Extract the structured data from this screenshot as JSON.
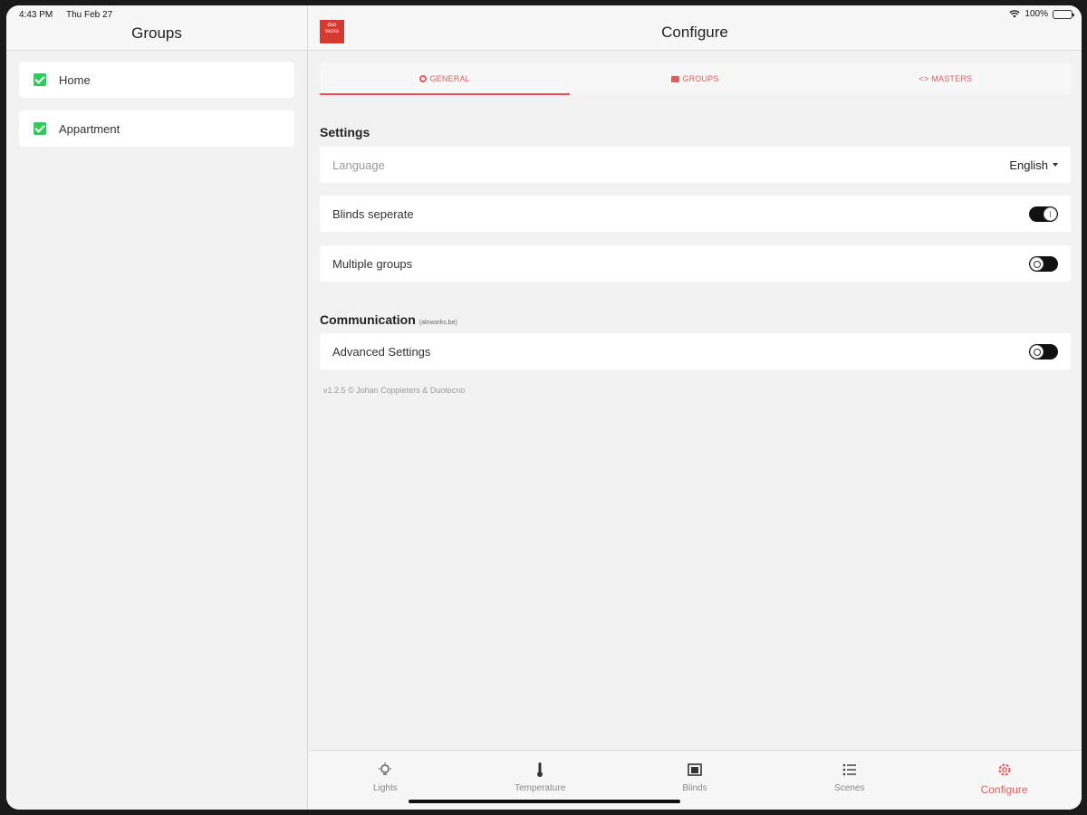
{
  "status": {
    "time": "4:43 PM",
    "date": "Thu Feb 27",
    "battery": "100%"
  },
  "left": {
    "title": "Groups",
    "groups": [
      {
        "label": "Home",
        "checked": true
      },
      {
        "label": "Appartment",
        "checked": true
      }
    ]
  },
  "header": {
    "title": "Configure",
    "logo_text": "duo tecno"
  },
  "tabs": [
    {
      "label": "GENERAL",
      "icon": "gear-icon",
      "active": true
    },
    {
      "label": "GROUPS",
      "icon": "folder-icon",
      "active": false
    },
    {
      "label": "MASTERS",
      "icon": "code-icon",
      "active": false
    }
  ],
  "settings": {
    "title": "Settings",
    "language_label": "Language",
    "language_value": "English",
    "blinds_label": "Blinds seperate",
    "blinds_on": true,
    "multiple_label": "Multiple groups",
    "multiple_on": false
  },
  "communication": {
    "title": "Communication",
    "subtitle": "(alnworks.be)",
    "advanced_label": "Advanced Settings",
    "advanced_on": false
  },
  "version": "v1.2.5 © Johan Coppieters & Duotecno",
  "bottom_tabs": [
    {
      "label": "Lights",
      "icon": "lightbulb-icon",
      "active": false
    },
    {
      "label": "Temperature",
      "icon": "thermometer-icon",
      "active": false
    },
    {
      "label": "Blinds",
      "icon": "blinds-icon",
      "active": false
    },
    {
      "label": "Scenes",
      "icon": "list-icon",
      "active": false
    },
    {
      "label": "Configure",
      "icon": "gear-icon",
      "active": true
    }
  ],
  "colors": {
    "accent": "#e8534f",
    "check": "#2ecc5a"
  }
}
